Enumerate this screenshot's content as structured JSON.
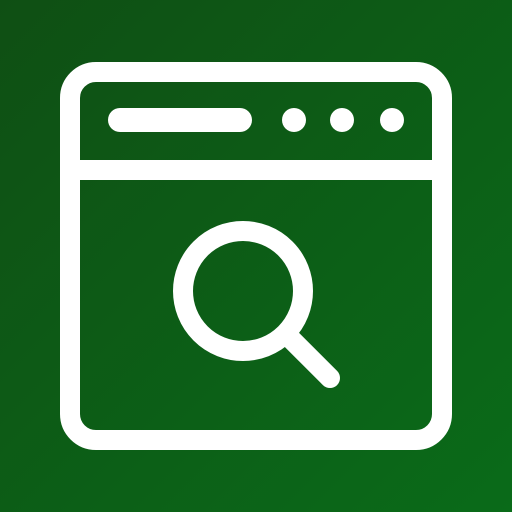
{
  "app_icon": {
    "name": "browser-search-icon",
    "background_gradient": {
      "from": "#0f4f14",
      "to": "#0a6b19"
    },
    "stroke_color": "#ffffff",
    "window": {
      "address_bar_icon": "address-bar-icon",
      "dots": [
        "window-dot-icon",
        "window-dot-icon",
        "window-dot-icon"
      ]
    },
    "content_icon": "search-icon"
  }
}
